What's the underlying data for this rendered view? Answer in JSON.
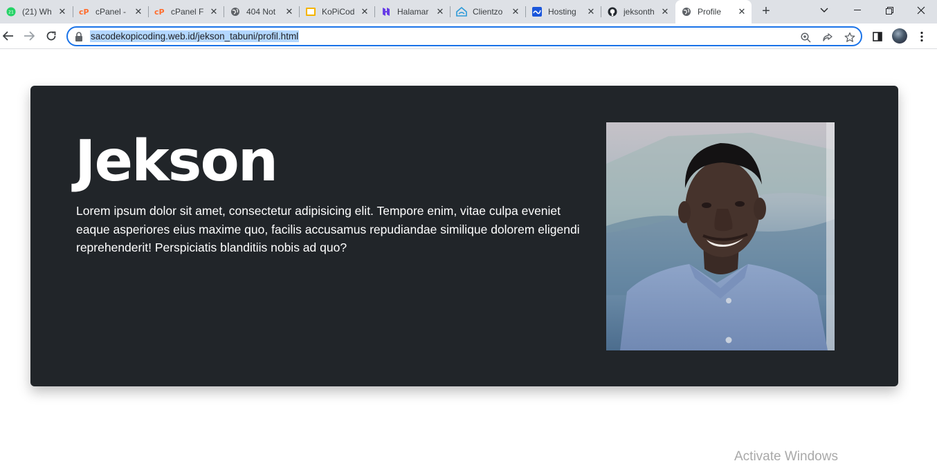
{
  "browser": {
    "tabs": [
      {
        "title": "(21) Wh",
        "favicon": "whatsapp-icon",
        "color": "#25d366"
      },
      {
        "title": "cPanel -",
        "favicon": "cpanel-icon",
        "color": "#ff6c2c"
      },
      {
        "title": "cPanel F",
        "favicon": "cpanel-icon",
        "color": "#ff6c2c"
      },
      {
        "title": "404 Not",
        "favicon": "globe-icon",
        "color": "#5f6368"
      },
      {
        "title": "KoPiCod",
        "favicon": "kopicoding-icon",
        "color": "#f4b400"
      },
      {
        "title": "Halamar",
        "favicon": "hostinger-icon",
        "color": "#673de6"
      },
      {
        "title": "Clientzo",
        "favicon": "clientzone-icon",
        "color": "#2c9ad8"
      },
      {
        "title": "Hosting",
        "favicon": "hosting-icon",
        "color": "#1a56db"
      },
      {
        "title": "jeksonth",
        "favicon": "github-icon",
        "color": "#24292f"
      },
      {
        "title": "Profile",
        "favicon": "globe-icon",
        "color": "#5f6368",
        "active": true
      }
    ],
    "url": "sacodekopicoding.web.id/jekson_tabuni/profil.html"
  },
  "hero": {
    "name": "Jekson",
    "bio": "Lorem ipsum dolor sit amet, consectetur adipisicing elit. Tempore enim, vitae culpa eveniet eaque asperiores eius maxime quo, facilis accusamus repudiandae similique dolorem eligendi reprehenderit! Perspiciatis blanditiis nobis ad quo?",
    "background": "#212529"
  },
  "overlay": {
    "watermark": "Activate Windows"
  }
}
